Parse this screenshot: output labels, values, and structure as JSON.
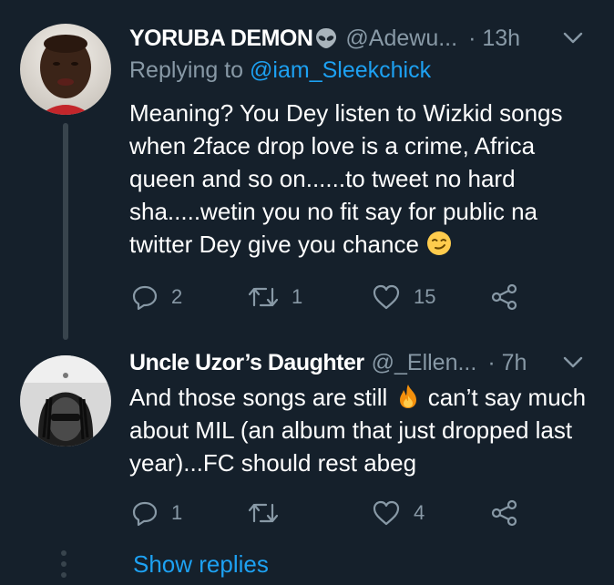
{
  "replies": [
    {
      "author_name": "YORUBA DEMON",
      "name_emoji": "alien-icon",
      "handle": "@Adewu...",
      "time": "· 13h",
      "replying_prefix": "Replying to ",
      "replying_to": "@iam_Sleekchick",
      "text": "Meaning? You Dey listen to Wizkid songs when 2face drop love is a crime, Africa queen and so on......to tweet no hard sha.....wetin you no fit say for public na twitter Dey give you chance",
      "text_emoji": "smirking-face-icon",
      "reply_count": "2",
      "retweet_count": "1",
      "like_count": "15"
    },
    {
      "author_name": "Uncle Uzor’s Daughter",
      "handle": "@_Ellen...",
      "time": "· 7h",
      "text_before_emoji": "And those songs are still ",
      "text_emoji": "fire-icon",
      "text_after_emoji": " can’t say much about MIL (an album that just dropped last year)...FC should rest abeg",
      "reply_count": "1",
      "retweet_count": "",
      "like_count": "4"
    }
  ],
  "show_replies_label": "Show replies",
  "colors": {
    "background": "#15202b",
    "secondary_text": "#8899a6",
    "link": "#1da1f2",
    "thread_line": "#38444d"
  }
}
